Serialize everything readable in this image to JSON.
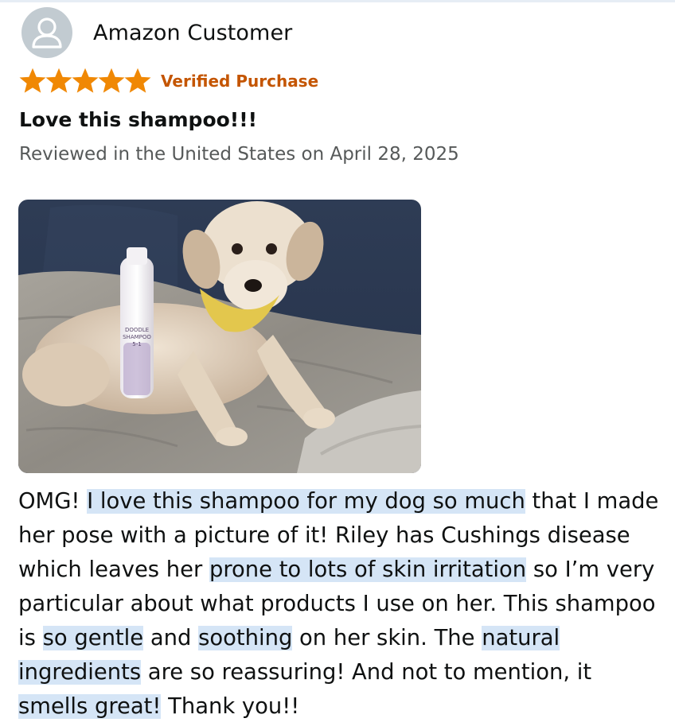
{
  "reviewer": {
    "name": "Amazon Customer",
    "avatar_icon": "person-icon"
  },
  "rating": {
    "stars": 5,
    "max": 5,
    "star_color": "#f08804",
    "star_icon": "star-icon"
  },
  "badge": {
    "label": "Verified Purchase",
    "color": "#c45500"
  },
  "review": {
    "title": "Love this shampoo!!!",
    "meta": "Reviewed in the United States on April 28, 2025",
    "photo": {
      "bottle_text": [
        "DOODLE",
        "SHAMPOO",
        "5-1"
      ]
    },
    "body": [
      {
        "text": "OMG! ",
        "highlight": false
      },
      {
        "text": "I love this shampoo for my dog so much",
        "highlight": true
      },
      {
        "text": " that I made her pose with a picture of it! Riley has Cushings disease which leaves her ",
        "highlight": false
      },
      {
        "text": "prone to lots of skin irritation",
        "highlight": true
      },
      {
        "text": " so I’m very particular about what products I use on her. This shampoo is ",
        "highlight": false
      },
      {
        "text": "so gentle",
        "highlight": true
      },
      {
        "text": " and ",
        "highlight": false
      },
      {
        "text": "soothing",
        "highlight": true
      },
      {
        "text": " on her skin. The ",
        "highlight": false
      },
      {
        "text": "natural ingredients",
        "highlight": true
      },
      {
        "text": " are so reassuring! And not to mention, it ",
        "highlight": false
      },
      {
        "text": "smells great!",
        "highlight": true
      },
      {
        "text": " Thank you!!",
        "highlight": false
      }
    ],
    "highlight_color": "#d5e5f6"
  }
}
